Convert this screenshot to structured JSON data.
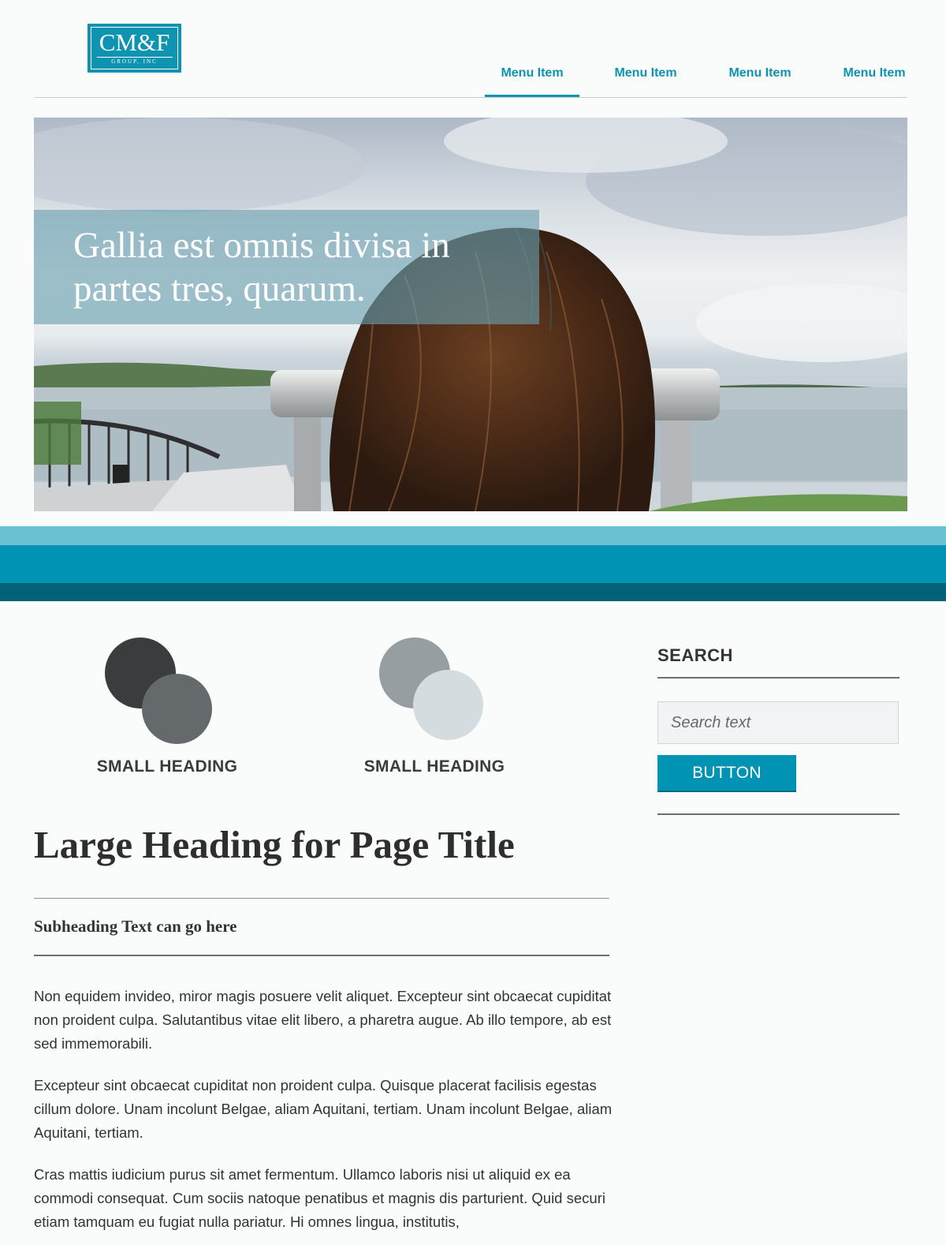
{
  "logo": {
    "main": "CM&F",
    "sub": "GROUP, INC"
  },
  "nav": {
    "items": [
      "Menu Item",
      "Menu Item",
      "Menu Item",
      "Menu Item"
    ],
    "active_index": 0
  },
  "hero": {
    "caption": "Gallia est omnis divisa in partes tres, quarum.",
    "image": "woman-looking-through-binoculars-at-river"
  },
  "colors": {
    "accent": "#0093b3",
    "band_light": "#69c2d4",
    "band_mid": "#0093b3",
    "band_dark": "#006179",
    "circle_dark_1": "#3a3c3e",
    "circle_dark_2": "#64696b",
    "circle_light_1": "#969ea1",
    "circle_light_2": "#d5dcdf"
  },
  "features": [
    {
      "heading": "SMALL HEADING"
    },
    {
      "heading": "SMALL HEADING"
    }
  ],
  "main": {
    "title": "Large Heading for Page Title",
    "subheading": "Subheading Text can go here",
    "paragraphs": [
      "Non equidem invideo, miror magis posuere velit aliquet. Excepteur sint obcaecat cupiditat non proident culpa. Salutantibus vitae elit libero, a pharetra augue. Ab illo tempore, ab est sed immemorabili.",
      "Excepteur sint obcaecat cupiditat non proident culpa. Quisque placerat facilisis egestas cillum dolore. Unam incolunt Belgae, aliam Aquitani, tertiam. Unam incolunt Belgae, aliam Aquitani, tertiam.",
      "Cras mattis iudicium purus sit amet fermentum. Ullamco laboris nisi ut aliquid ex ea commodi consequat. Cum sociis natoque penatibus et magnis dis parturient. Quid securi etiam tamquam eu fugiat nulla pariatur. Hi omnes lingua, institutis,"
    ]
  },
  "sidebar": {
    "title": "SEARCH",
    "search_placeholder": "Search text",
    "button_label": "BUTTON"
  }
}
